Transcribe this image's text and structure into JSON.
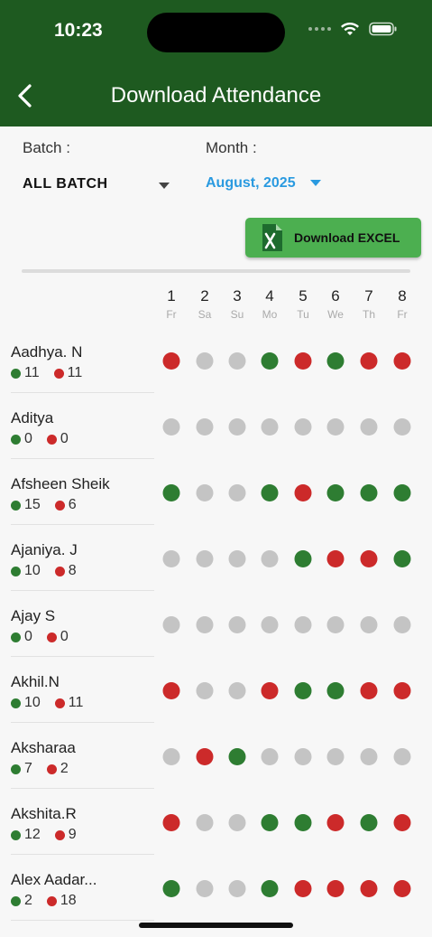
{
  "status_bar": {
    "time": "10:23"
  },
  "header": {
    "title": "Download Attendance"
  },
  "filters": {
    "batch_label": "Batch :",
    "batch_value": "ALL BATCH",
    "month_label": "Month :",
    "month_value": "August, 2025"
  },
  "actions": {
    "download_excel": "Download EXCEL"
  },
  "colors": {
    "present": "#2e7d32",
    "absent": "#cc2a2a",
    "none": "#c4c4c4",
    "header": "#1e5a20",
    "button": "#4caf50",
    "link": "#2a9ae0"
  },
  "days": [
    {
      "num": "1",
      "name": "Fr"
    },
    {
      "num": "2",
      "name": "Sa"
    },
    {
      "num": "3",
      "name": "Su"
    },
    {
      "num": "4",
      "name": "Mo"
    },
    {
      "num": "5",
      "name": "Tu"
    },
    {
      "num": "6",
      "name": "We"
    },
    {
      "num": "7",
      "name": "Th"
    },
    {
      "num": "8",
      "name": "Fr"
    }
  ],
  "students": [
    {
      "name": "Aadhya. N",
      "present": "11",
      "absent": "11",
      "attendance": [
        "A",
        "N",
        "N",
        "P",
        "A",
        "P",
        "A",
        "A"
      ]
    },
    {
      "name": "Aditya",
      "present": "0",
      "absent": "0",
      "attendance": [
        "N",
        "N",
        "N",
        "N",
        "N",
        "N",
        "N",
        "N"
      ]
    },
    {
      "name": "Afsheen Sheik",
      "present": "15",
      "absent": "6",
      "attendance": [
        "P",
        "N",
        "N",
        "P",
        "A",
        "P",
        "P",
        "P"
      ]
    },
    {
      "name": "Ajaniya. J",
      "present": "10",
      "absent": "8",
      "attendance": [
        "N",
        "N",
        "N",
        "N",
        "P",
        "A",
        "A",
        "P"
      ]
    },
    {
      "name": "Ajay S",
      "present": "0",
      "absent": "0",
      "attendance": [
        "N",
        "N",
        "N",
        "N",
        "N",
        "N",
        "N",
        "N"
      ]
    },
    {
      "name": "Akhil.N",
      "present": "10",
      "absent": "11",
      "attendance": [
        "A",
        "N",
        "N",
        "A",
        "P",
        "P",
        "A",
        "A"
      ]
    },
    {
      "name": "Aksharaa",
      "present": "7",
      "absent": "2",
      "attendance": [
        "N",
        "A",
        "P",
        "N",
        "N",
        "N",
        "N",
        "N"
      ]
    },
    {
      "name": "Akshita.R",
      "present": "12",
      "absent": "9",
      "attendance": [
        "A",
        "N",
        "N",
        "P",
        "P",
        "A",
        "P",
        "A"
      ]
    },
    {
      "name": "Alex Aadar...",
      "present": "2",
      "absent": "18",
      "attendance": [
        "P",
        "N",
        "N",
        "P",
        "A",
        "A",
        "A",
        "A"
      ]
    }
  ]
}
